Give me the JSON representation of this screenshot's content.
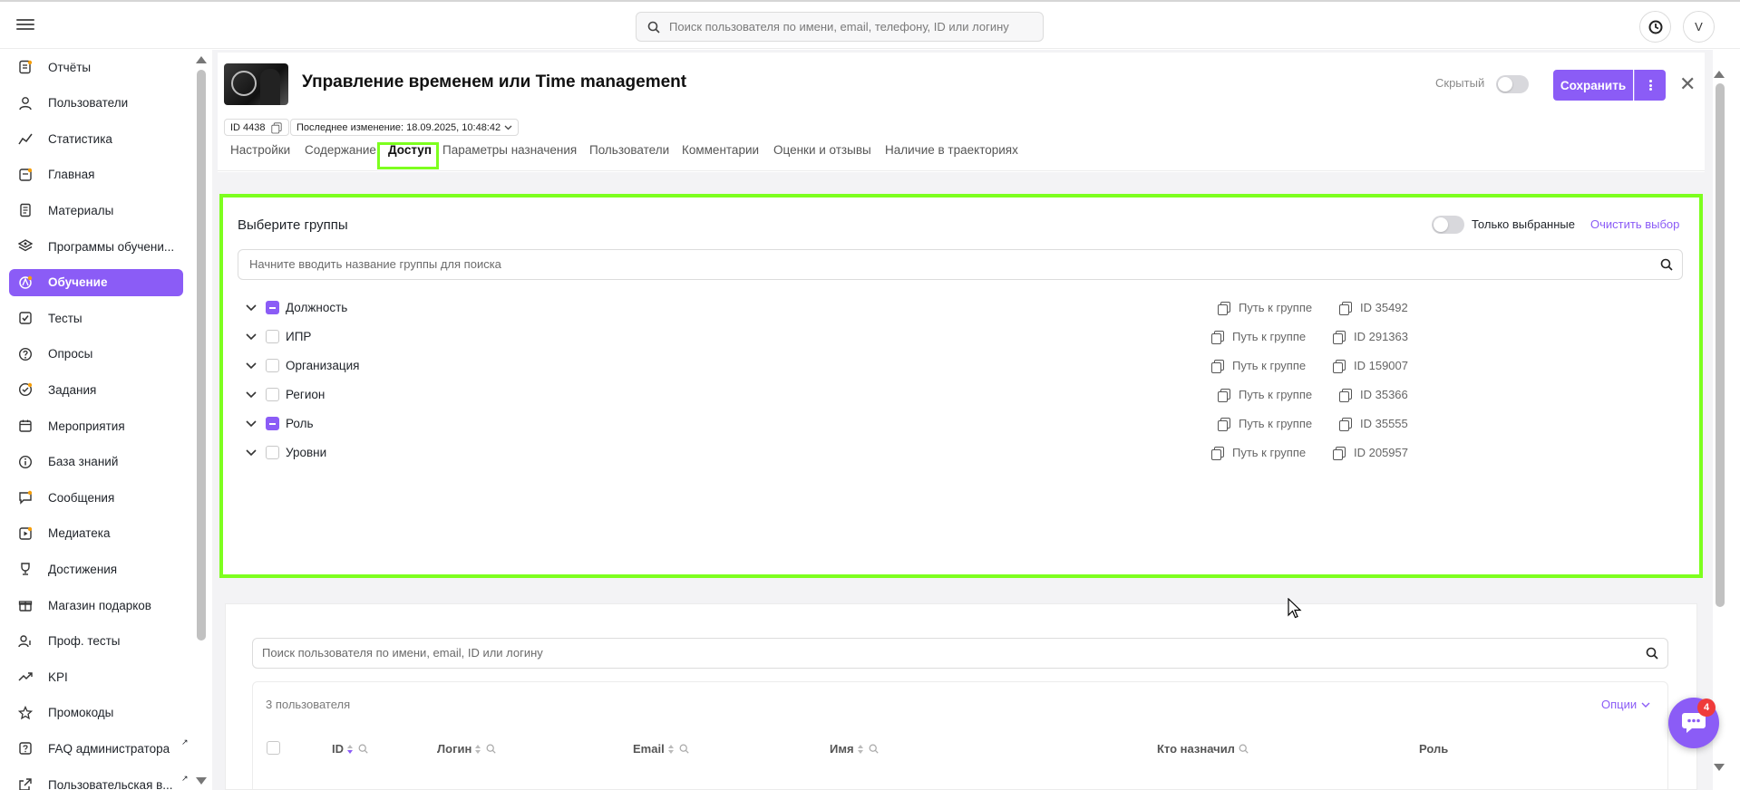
{
  "topbar": {
    "search_placeholder": "Поиск пользователя по имени, email, телефону, ID или логину",
    "avatar_letter": "V"
  },
  "sidebar": {
    "items": [
      {
        "label": "Отчёты",
        "icon": "report-icon"
      },
      {
        "label": "Пользователи",
        "icon": "user-icon"
      },
      {
        "label": "Статистика",
        "icon": "chart-line-icon"
      },
      {
        "label": "Главная",
        "icon": "home-icon"
      },
      {
        "label": "Материалы",
        "icon": "document-icon"
      },
      {
        "label": "Программы обучени...",
        "icon": "layers-icon"
      },
      {
        "label": "Обучение",
        "icon": "learning-icon",
        "active": true
      },
      {
        "label": "Тесты",
        "icon": "test-icon"
      },
      {
        "label": "Опросы",
        "icon": "question-icon"
      },
      {
        "label": "Задания",
        "icon": "task-icon"
      },
      {
        "label": "Мероприятия",
        "icon": "calendar-icon"
      },
      {
        "label": "База знаний",
        "icon": "info-icon"
      },
      {
        "label": "Сообщения",
        "icon": "message-icon"
      },
      {
        "label": "Медиатека",
        "icon": "media-icon"
      },
      {
        "label": "Достижения",
        "icon": "trophy-icon"
      },
      {
        "label": "Магазин подарков",
        "icon": "gift-icon"
      },
      {
        "label": "Проф. тесты",
        "icon": "prof-test-icon"
      },
      {
        "label": "KPI",
        "icon": "trend-icon"
      },
      {
        "label": "Промокоды",
        "icon": "star-icon"
      },
      {
        "label": "FAQ администратора",
        "icon": "faq-icon",
        "external": true
      },
      {
        "label": "Пользовательская в...",
        "icon": "external-link-icon",
        "external": true
      }
    ]
  },
  "course": {
    "title": "Управление временем или Time management",
    "hidden_label": "Скрытый",
    "save_label": "Сохранить",
    "id_chip": "ID 4438",
    "last_change": "Последнее изменение: 18.09.2025, 10:48:42"
  },
  "tabs": [
    {
      "label": "Настройки"
    },
    {
      "label": "Содержание"
    },
    {
      "label": "Доступ",
      "active": true
    },
    {
      "label": "Параметры назначения"
    },
    {
      "label": "Пользователи"
    },
    {
      "label": "Комментарии"
    },
    {
      "label": "Оценки и отзывы"
    },
    {
      "label": "Наличие в траекториях"
    }
  ],
  "groups": {
    "title": "Выберите группы",
    "only_selected_label": "Только выбранные",
    "clear_label": "Очистить выбор",
    "search_placeholder": "Начните вводить название группы для поиска",
    "path_label": "Путь к группе",
    "rows": [
      {
        "name": "Должность",
        "id": "ID 35492",
        "state": "partial"
      },
      {
        "name": "ИПР",
        "id": "ID 291363",
        "state": "empty"
      },
      {
        "name": "Организация",
        "id": "ID 159007",
        "state": "empty"
      },
      {
        "name": "Регион",
        "id": "ID 35366",
        "state": "empty"
      },
      {
        "name": "Роль",
        "id": "ID 35555",
        "state": "partial"
      },
      {
        "name": "Уровни",
        "id": "ID 205957",
        "state": "empty"
      }
    ]
  },
  "users": {
    "search_placeholder": "Поиск пользователя по имени, email, ID или логину",
    "count_label": "3 пользователя",
    "options_label": "Опции",
    "columns": [
      "ID",
      "Логин",
      "Email",
      "Имя",
      "Кто назначил",
      "Роль"
    ]
  },
  "chat": {
    "badge": "4"
  },
  "colors": {
    "accent": "#8b5cf6",
    "highlight": "#7dff1e",
    "badge": "#ef3b3b"
  }
}
